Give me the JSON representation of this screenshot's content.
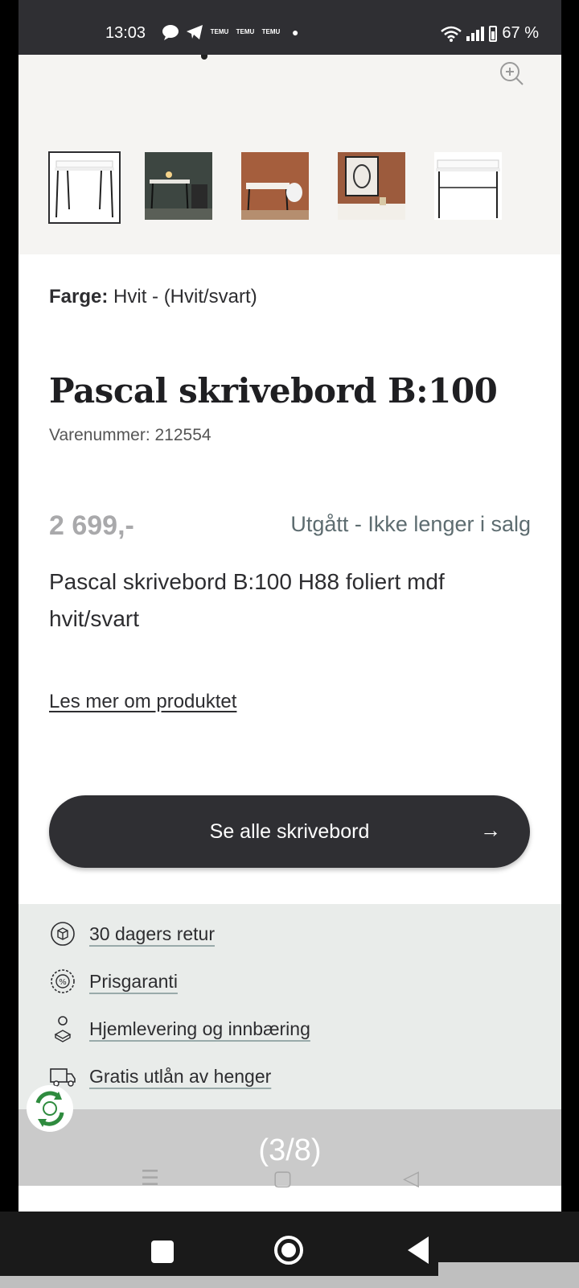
{
  "status_bar": {
    "time": "13:03",
    "notification_labels": [
      "TEMU",
      "TEMU",
      "TEMU"
    ],
    "battery": "67 %"
  },
  "product": {
    "color_label": "Farge:",
    "color_value": "Hvit - (Hvit/svart)",
    "title": "Pascal skrivebord B:100",
    "sku": "Varenummer: 212554",
    "price": "2 699,-",
    "availability": "Utgått - Ikke lenger i salg",
    "description": "Pascal skrivebord B:100 H88 foliert mdf hvit/svart",
    "read_more": "Les mer om produktet",
    "cta_label": "Se alle skrivebord",
    "cta_arrow": "→"
  },
  "usp": [
    {
      "icon": "return-box-icon",
      "label": "30 dagers retur"
    },
    {
      "icon": "price-guarantee-icon",
      "label": "Prisgaranti"
    },
    {
      "icon": "home-delivery-icon",
      "label": "Hjemlevering og innbæring"
    },
    {
      "icon": "trailer-icon",
      "label": "Gratis utlån av henger"
    }
  ],
  "overlay": {
    "counter": "(3/8)"
  },
  "gallery": {
    "thumbnails": [
      "desk-white-front",
      "desk-room-dark",
      "desk-room-orange",
      "desk-art-wall",
      "desk-white-side"
    ],
    "selected_index": 0
  },
  "colors": {
    "dark": "#2f2f33",
    "muted_teal": "#5d6c70",
    "usp_bg": "#e9ecea",
    "gallery_bg": "#f5f4f2"
  }
}
